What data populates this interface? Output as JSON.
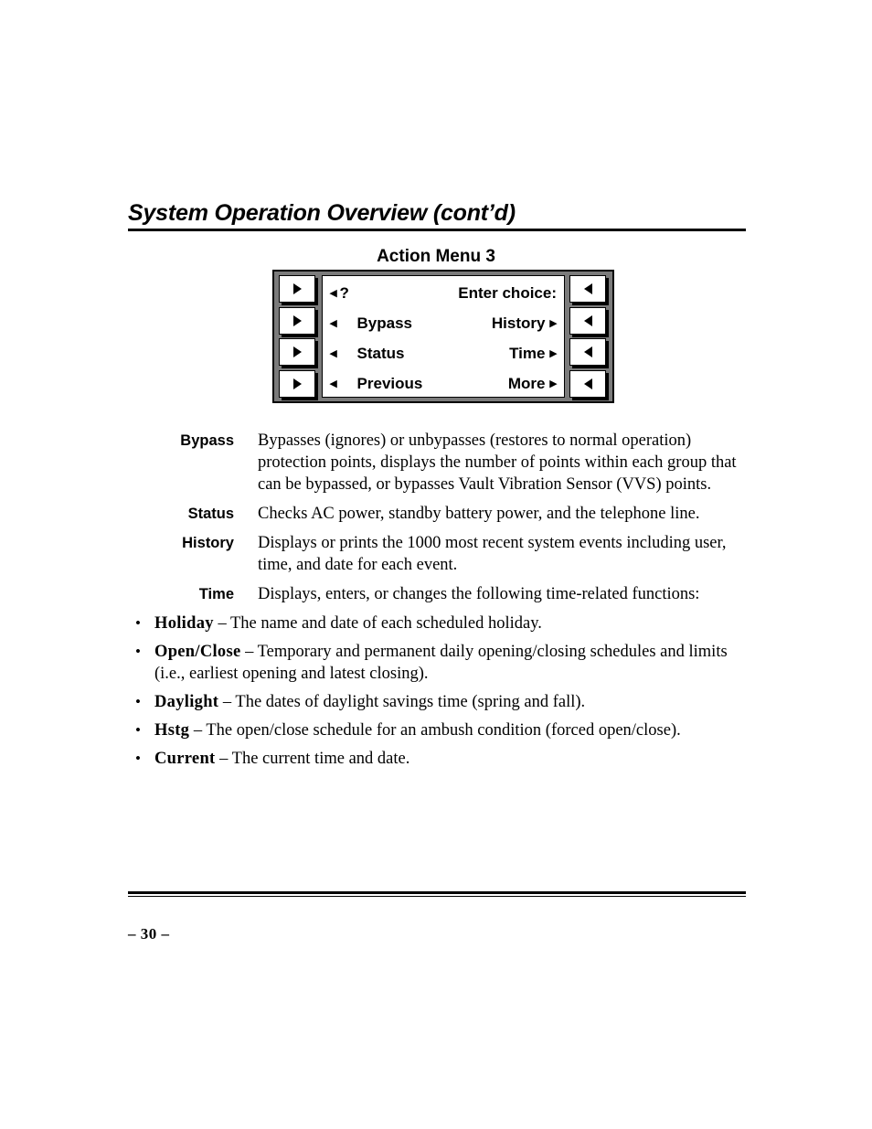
{
  "header": {
    "title": "System Operation Overview (cont’d)"
  },
  "figure": {
    "title": "Action Menu 3",
    "left_buttons": [
      {
        "icon": "triangle-right-icon"
      },
      {
        "icon": "triangle-right-icon"
      },
      {
        "icon": "triangle-right-icon"
      },
      {
        "icon": "triangle-right-icon"
      }
    ],
    "right_buttons": [
      {
        "icon": "triangle-left-icon"
      },
      {
        "icon": "triangle-left-icon"
      },
      {
        "icon": "triangle-left-icon"
      },
      {
        "icon": "triangle-left-icon"
      }
    ],
    "lcd_rows": [
      {
        "left_arrow": "◂",
        "left_label": "?",
        "right_label": "Enter choice:",
        "right_arrow": ""
      },
      {
        "left_arrow": "◂",
        "left_label": "Bypass",
        "right_label": "History",
        "right_arrow": "▸"
      },
      {
        "left_arrow": "◂",
        "left_label": "Status",
        "right_label": "Time",
        "right_arrow": "▸"
      },
      {
        "left_arrow": "◂",
        "left_label": "Previous",
        "right_label": "More",
        "right_arrow": "▸"
      }
    ]
  },
  "definitions": [
    {
      "term": "Bypass",
      "description": "Bypasses (ignores) or unbypasses (restores to normal operation) protection points, displays the number of points within each group that can be bypassed, or bypasses Vault Vibration Sensor (VVS) points."
    },
    {
      "term": "Status",
      "description": "Checks AC power, standby battery power, and the telephone line."
    },
    {
      "term": "History",
      "description": "Displays or prints the 1000 most recent system events including user, time, and date for each event."
    },
    {
      "term": "Time",
      "description": "Displays, enters, or changes the following time-related functions:"
    }
  ],
  "bullets": [
    {
      "marker": "•",
      "term": "Holiday",
      "text": " – The name and date of each scheduled holiday."
    },
    {
      "marker": "•",
      "term": "Open/Close",
      "text": " – Temporary and permanent daily opening/closing schedules and limits (i.e., earliest opening and latest closing)."
    },
    {
      "marker": "•",
      "term": "Daylight",
      "text": " – The dates of daylight savings time (spring and fall)."
    },
    {
      "marker": "•",
      "term": "Hstg",
      "text": " – The open/close schedule for an ambush condition (forced open/close)."
    },
    {
      "marker": "•",
      "term": "Current",
      "text": " – The current time and date."
    }
  ],
  "footer": {
    "page_number": "– 30 –"
  }
}
